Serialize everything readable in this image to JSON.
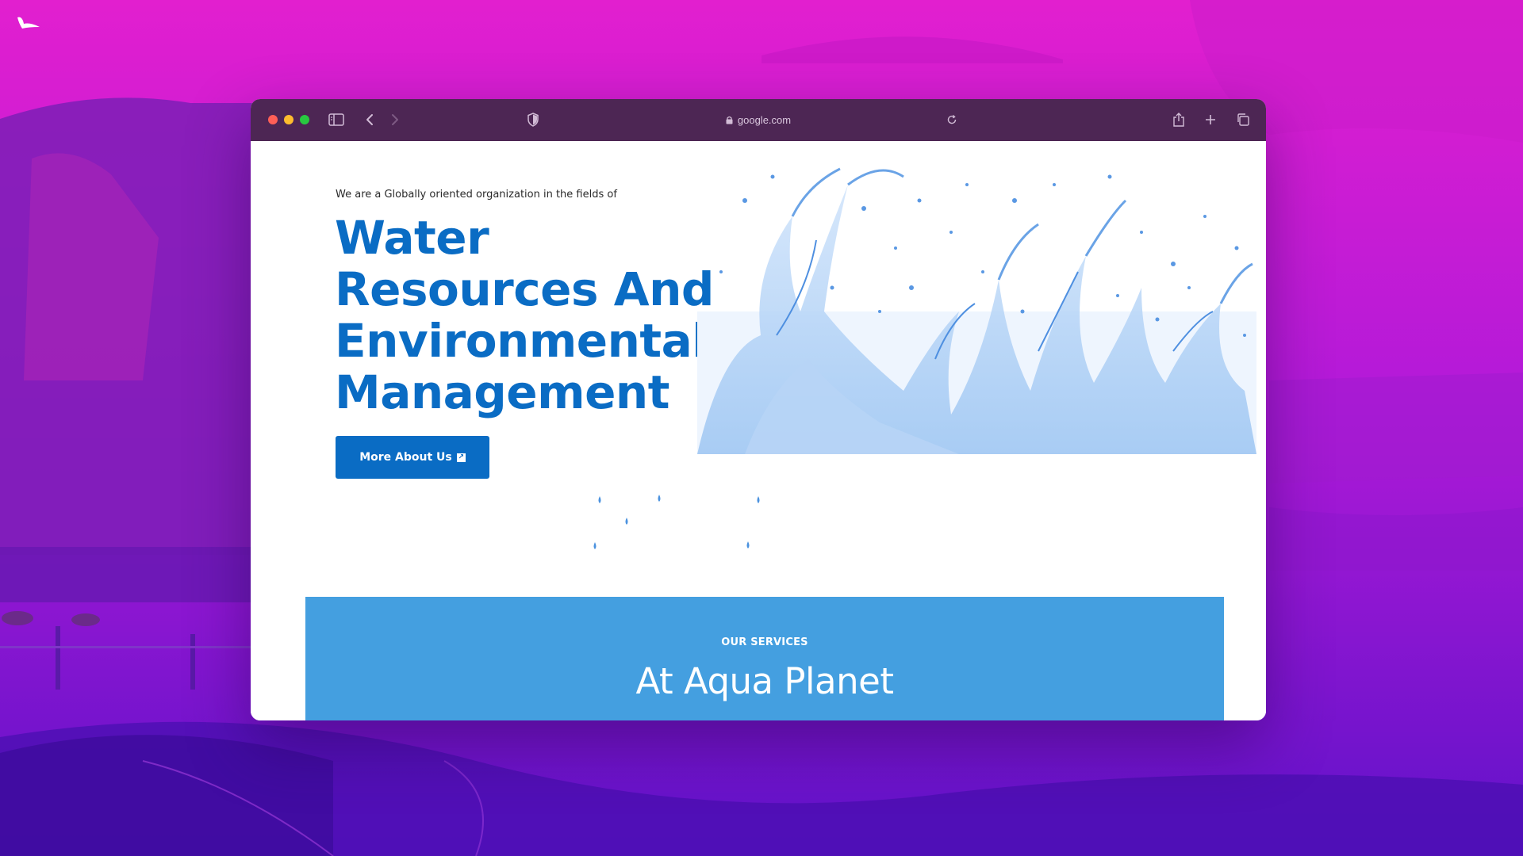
{
  "browser": {
    "url": "google.com",
    "icons": [
      "sidebar-icon",
      "back-icon",
      "forward-icon",
      "shield-icon",
      "lock-icon",
      "reload-icon",
      "share-icon",
      "new-tab-icon",
      "tabs-overview-icon"
    ]
  },
  "hero": {
    "tagline": "We are a Globally oriented organization in the fields of",
    "headline_lines": [
      "Water",
      "Resources And",
      "Environmental",
      "Management"
    ],
    "cta_label": "More About Us",
    "cta_icon": "external-arrow-icon"
  },
  "services": {
    "eyebrow": "OUR SERVICES",
    "title": "At Aqua Planet"
  },
  "colors": {
    "brand_blue": "#0a6cc4",
    "services_bg": "#449fe0",
    "toolbar_bg": "#4d2654"
  }
}
